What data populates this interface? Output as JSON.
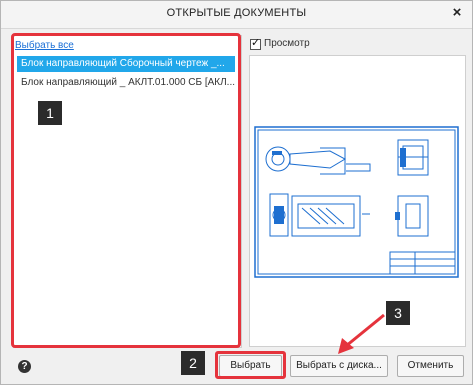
{
  "dialog": {
    "title": "ОТКРЫТЫЕ ДОКУМЕНТЫ",
    "close_label": "×"
  },
  "list": {
    "select_all_label": "Выбрать все",
    "items": [
      {
        "label": "Блок направляющий Сборочный чертеж _...",
        "selected": true
      },
      {
        "label": "Блок направляющий _ АКЛТ.01.000 СБ [АКЛ...",
        "selected": false
      }
    ]
  },
  "preview": {
    "checkbox_label": "Просмотр",
    "checked": true
  },
  "footer": {
    "help_label": "?",
    "select_button": "Выбрать",
    "select_from_disk_button": "Выбрать с диска...",
    "cancel_button": "Отменить"
  },
  "annotations": {
    "badge_1": "1",
    "badge_2": "2",
    "badge_3": "3",
    "highlight_color": "#e5333c"
  }
}
